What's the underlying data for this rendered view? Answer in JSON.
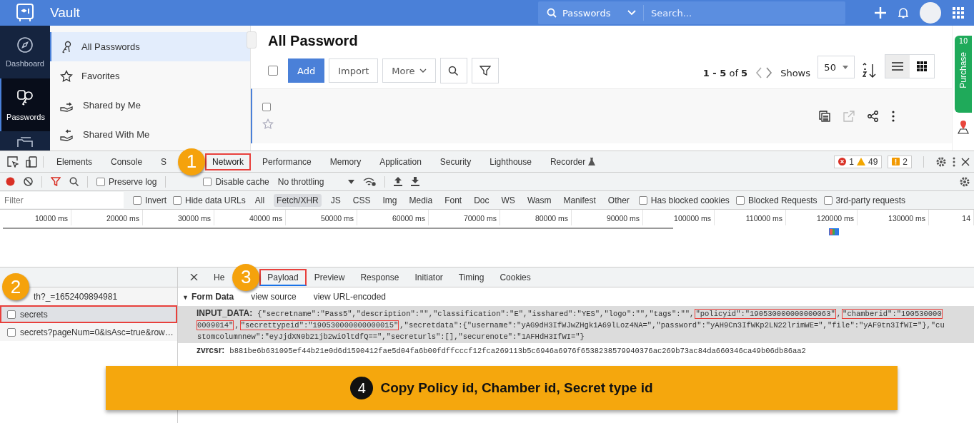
{
  "app": {
    "title": "Vault",
    "search_scope": "Passwords",
    "search": {
      "placeholder": "Search..."
    }
  },
  "nav": [
    {
      "label": "Dashboard",
      "kind": "compass",
      "selected": false
    },
    {
      "label": "Passwords",
      "kind": "key",
      "selected": true
    }
  ],
  "subnav": [
    {
      "label": "All Passwords",
      "kind": "keys",
      "selected": true
    },
    {
      "label": "Favorites",
      "kind": "star",
      "selected": false
    },
    {
      "label": "Shared by Me",
      "kind": "share-out",
      "selected": false
    },
    {
      "label": "Shared With Me",
      "kind": "share-in",
      "selected": false
    }
  ],
  "page": {
    "title": "All Password",
    "select_all": {
      "checked": false
    },
    "buttons": [
      {
        "label": "Add",
        "kind": "primary"
      },
      {
        "label": "Import",
        "kind": "plain"
      },
      {
        "label": "More",
        "kind": "dropdown"
      }
    ],
    "range": "1 - 5",
    "of": "of",
    "total": "5",
    "shows_label": "Shows",
    "page_size": "50",
    "views": [
      {
        "kind": "list",
        "selected": true
      },
      {
        "kind": "grid",
        "selected": false
      }
    ]
  },
  "row": {
    "checked": false,
    "favorite": false
  },
  "trial": {
    "days": "10",
    "label": "Purchase"
  },
  "devtools": {
    "tabs": [
      {
        "label": "Elements",
        "selected": false,
        "highlighted": false
      },
      {
        "label": "Console",
        "selected": false,
        "highlighted": false
      },
      {
        "label": "S",
        "selected": false,
        "highlighted": false
      },
      {
        "label": "Network",
        "selected": true,
        "highlighted": true
      },
      {
        "label": "Performance",
        "selected": false,
        "highlighted": false
      },
      {
        "label": "Memory",
        "selected": false,
        "highlighted": false
      },
      {
        "label": "Application",
        "selected": false,
        "highlighted": false
      },
      {
        "label": "Security",
        "selected": false,
        "highlighted": false
      },
      {
        "label": "Lighthouse",
        "selected": false,
        "highlighted": false
      },
      {
        "label": "Recorder",
        "selected": false,
        "highlighted": false
      }
    ],
    "errors": "1",
    "warnings": "49",
    "issues": "2",
    "preserve_log": {
      "label": "Preserve log",
      "checked": false
    },
    "disable_cache": {
      "label": "Disable cache",
      "checked": false
    },
    "throttling": "No throttling",
    "filter": {
      "placeholder": "Filter"
    },
    "filter_options": [
      {
        "label": "Invert",
        "kind": "checkbox",
        "checked": false
      },
      {
        "label": "Hide data URLs",
        "kind": "checkbox",
        "checked": false
      },
      {
        "label": "All",
        "kind": "type",
        "selected": false
      },
      {
        "label": "Fetch/XHR",
        "kind": "type",
        "selected": true
      },
      {
        "label": "JS",
        "kind": "type",
        "selected": false
      },
      {
        "label": "CSS",
        "kind": "type",
        "selected": false
      },
      {
        "label": "Img",
        "kind": "type",
        "selected": false
      },
      {
        "label": "Media",
        "kind": "type",
        "selected": false
      },
      {
        "label": "Font",
        "kind": "type",
        "selected": false
      },
      {
        "label": "Doc",
        "kind": "type",
        "selected": false
      },
      {
        "label": "WS",
        "kind": "type",
        "selected": false
      },
      {
        "label": "Wasm",
        "kind": "type",
        "selected": false
      },
      {
        "label": "Manifest",
        "kind": "type",
        "selected": false
      },
      {
        "label": "Other",
        "kind": "type",
        "selected": false
      },
      {
        "label": "Has blocked cookies",
        "kind": "checkbox",
        "checked": false
      },
      {
        "label": "Blocked Requests",
        "kind": "checkbox",
        "checked": false
      },
      {
        "label": "3rd-party requests",
        "kind": "checkbox",
        "checked": false
      }
    ],
    "ticks": [
      "10000 ms",
      "20000 ms",
      "30000 ms",
      "40000 ms",
      "50000 ms",
      "60000 ms",
      "70000 ms",
      "80000 ms",
      "90000 ms",
      "100000 ms",
      "110000 ms",
      "120000 ms",
      "130000 ms",
      "14"
    ],
    "requests": [
      {
        "name": "th?_=1652409894981",
        "selected": false,
        "highlighted": false
      },
      {
        "name": "secrets",
        "selected": true,
        "highlighted": true
      },
      {
        "name": "secrets?pageNum=0&isAsc=true&row…",
        "selected": false,
        "highlighted": false
      }
    ],
    "detail_tabs": [
      {
        "label": "He",
        "selected": false,
        "highlighted": false
      },
      {
        "label": "Payload",
        "selected": true,
        "highlighted": true
      },
      {
        "label": "Preview",
        "selected": false,
        "highlighted": false
      },
      {
        "label": "Response",
        "selected": false,
        "highlighted": false
      },
      {
        "label": "Initiator",
        "selected": false,
        "highlighted": false
      },
      {
        "label": "Timing",
        "selected": false,
        "highlighted": false
      },
      {
        "label": "Cookies",
        "selected": false,
        "highlighted": false
      }
    ],
    "form_data": {
      "toggle": "▼",
      "title": "Form Data",
      "links": [
        "view source",
        "view URL-encoded"
      ],
      "fields": [
        {
          "key": "INPUT_DATA:",
          "selected": true,
          "lines": [
            [
              {
                "text": "{\"secretname\":\"Pass5\",\"description\":\"\",\"classification\":\"E\",\"isshared\":\"YES\",\"logo\":\"\",\"tags\":\"\",",
                "highlighted": false
              },
              {
                "text": "\"policyid\":\"190530000000000063\"",
                "highlighted": true
              },
              {
                "text": ",",
                "highlighted": false
              },
              {
                "text": "\"chamberid\":\"190530000",
                "highlighted": true
              }
            ],
            [
              {
                "text": "0009014\"",
                "highlighted": true
              },
              {
                "text": ",",
                "highlighted": false
              },
              {
                "text": "\"secrettypeid\":\"190530000000000015\"",
                "highlighted": true
              },
              {
                "text": ",\"secretdata\":{\"username\":\"yAG9dH3IfWJwZHgk1A69lLoz4NA=\",\"password\":\"yAH9Cn3IfWKp2LN22lrimWE=\",\"file\":\"yAF9tn3IfWI=\"},\"cu",
                "highlighted": false
              }
            ],
            [
              {
                "text": "stomcolumnnew\":\"eyJjdXN0b21jb2wiOltdfQ==\",\"secreturls\":[],\"securenote\":\"1AFHdH3IfWI=\"}",
                "highlighted": false
              }
            ]
          ]
        },
        {
          "key": "zvrcsr:",
          "selected": false,
          "lines": [
            [
              {
                "text": "b881be6b631095ef44b21e0d6d1590412fae5d04fa6b00fdffcccf12fca269113b5c6946a6976f6538238579940376ac269b73ac84da660346ca49b06db86aa2",
                "highlighted": false
              }
            ]
          ]
        }
      ]
    }
  },
  "annotations": [
    {
      "number": "1"
    },
    {
      "number": "2"
    },
    {
      "number": "3"
    }
  ],
  "banner": {
    "number": "4",
    "text": "Copy Policy id, Chamber id, Secret type id"
  }
}
